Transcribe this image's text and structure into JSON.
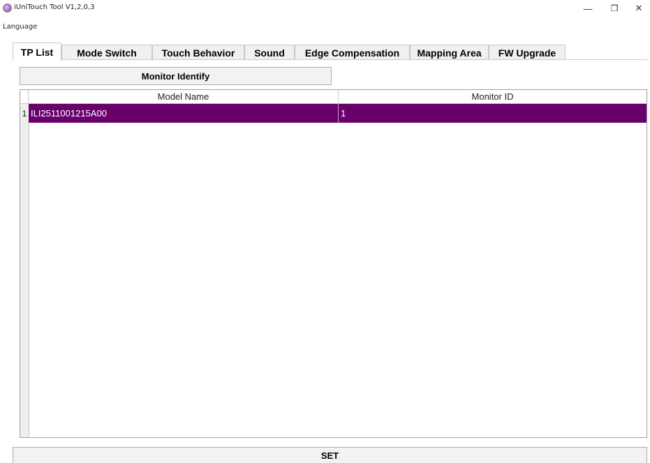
{
  "window": {
    "title": "iUniTouch Tool V1,2,0,3",
    "minimize_glyph": "—",
    "restore_glyph": "❐",
    "close_glyph": "✕"
  },
  "menu": {
    "items": [
      {
        "label": "Language"
      }
    ]
  },
  "tabs": [
    {
      "label": "TP List",
      "active": true
    },
    {
      "label": "Mode Switch"
    },
    {
      "label": "Touch Behavior"
    },
    {
      "label": "Sound"
    },
    {
      "label": "Edge Compensation"
    },
    {
      "label": "Mapping Area"
    },
    {
      "label": "FW Upgrade"
    }
  ],
  "tp_list": {
    "identify_button": "Monitor Identify",
    "columns": [
      "Model Name",
      "Monitor ID"
    ],
    "rows": [
      {
        "index": "1",
        "model_name": "ILI2511001215A00",
        "monitor_id": "1",
        "selected": true
      }
    ],
    "selection_color": "#6a006b"
  },
  "set_button": "SET"
}
